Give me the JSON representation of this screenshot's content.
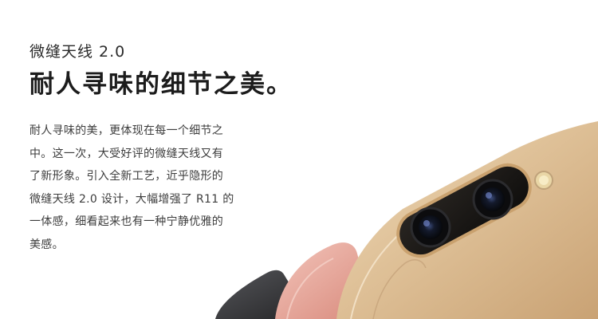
{
  "hero": {
    "subtitle": "微缝天线 2.0",
    "headline": "耐人寻味的细节之美。",
    "paragraph_lines": [
      "耐人寻味的美，更体现在每一个细节之",
      "中。这一次，大受好评的微缝天线又有",
      "了新形象。引入全新工艺，近乎隐形的",
      "微缝天线 2.0 设计，大幅增强了 R11 的",
      "一体感，细看起来也有一种宁静优雅的",
      "美感。"
    ]
  },
  "phones": [
    {
      "color_name": "black",
      "color": "#3a3a3c"
    },
    {
      "color_name": "rose-gold",
      "color": "#e4a89c"
    },
    {
      "color_name": "gold",
      "color": "#dcbd92"
    }
  ],
  "camera": {
    "lens_count": 2,
    "ring_color": "#c9a16e",
    "flash_color": "#f3e2a0"
  }
}
